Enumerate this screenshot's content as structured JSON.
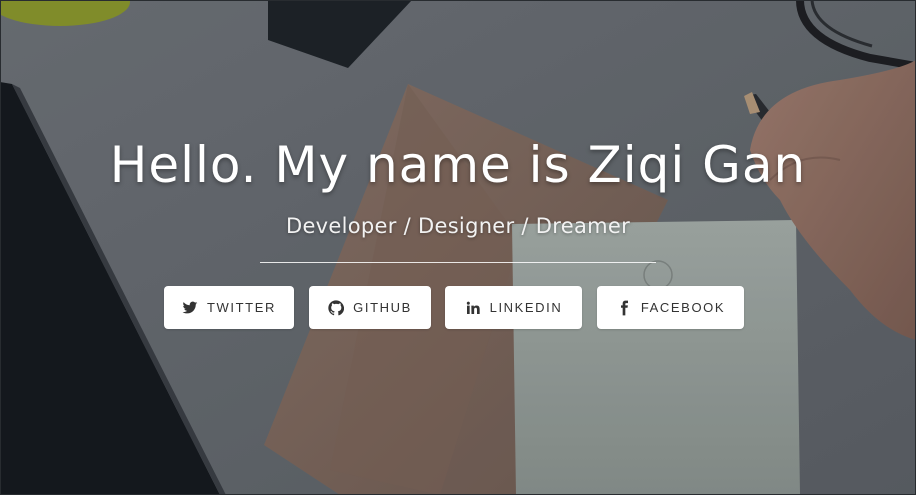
{
  "hero": {
    "title": "Hello. My name is Ziqi Gan",
    "subtitle": "Developer / Designer / Dreamer"
  },
  "social_links": [
    {
      "label": "TWITTER",
      "icon": "twitter-icon"
    },
    {
      "label": "GITHUB",
      "icon": "github-icon"
    },
    {
      "label": "LINKEDIN",
      "icon": "linkedin-icon"
    },
    {
      "label": "FACEBOOK",
      "icon": "facebook-icon"
    }
  ],
  "colors": {
    "text": "#ffffff",
    "button_bg": "#ffffff",
    "button_text": "#333333"
  }
}
